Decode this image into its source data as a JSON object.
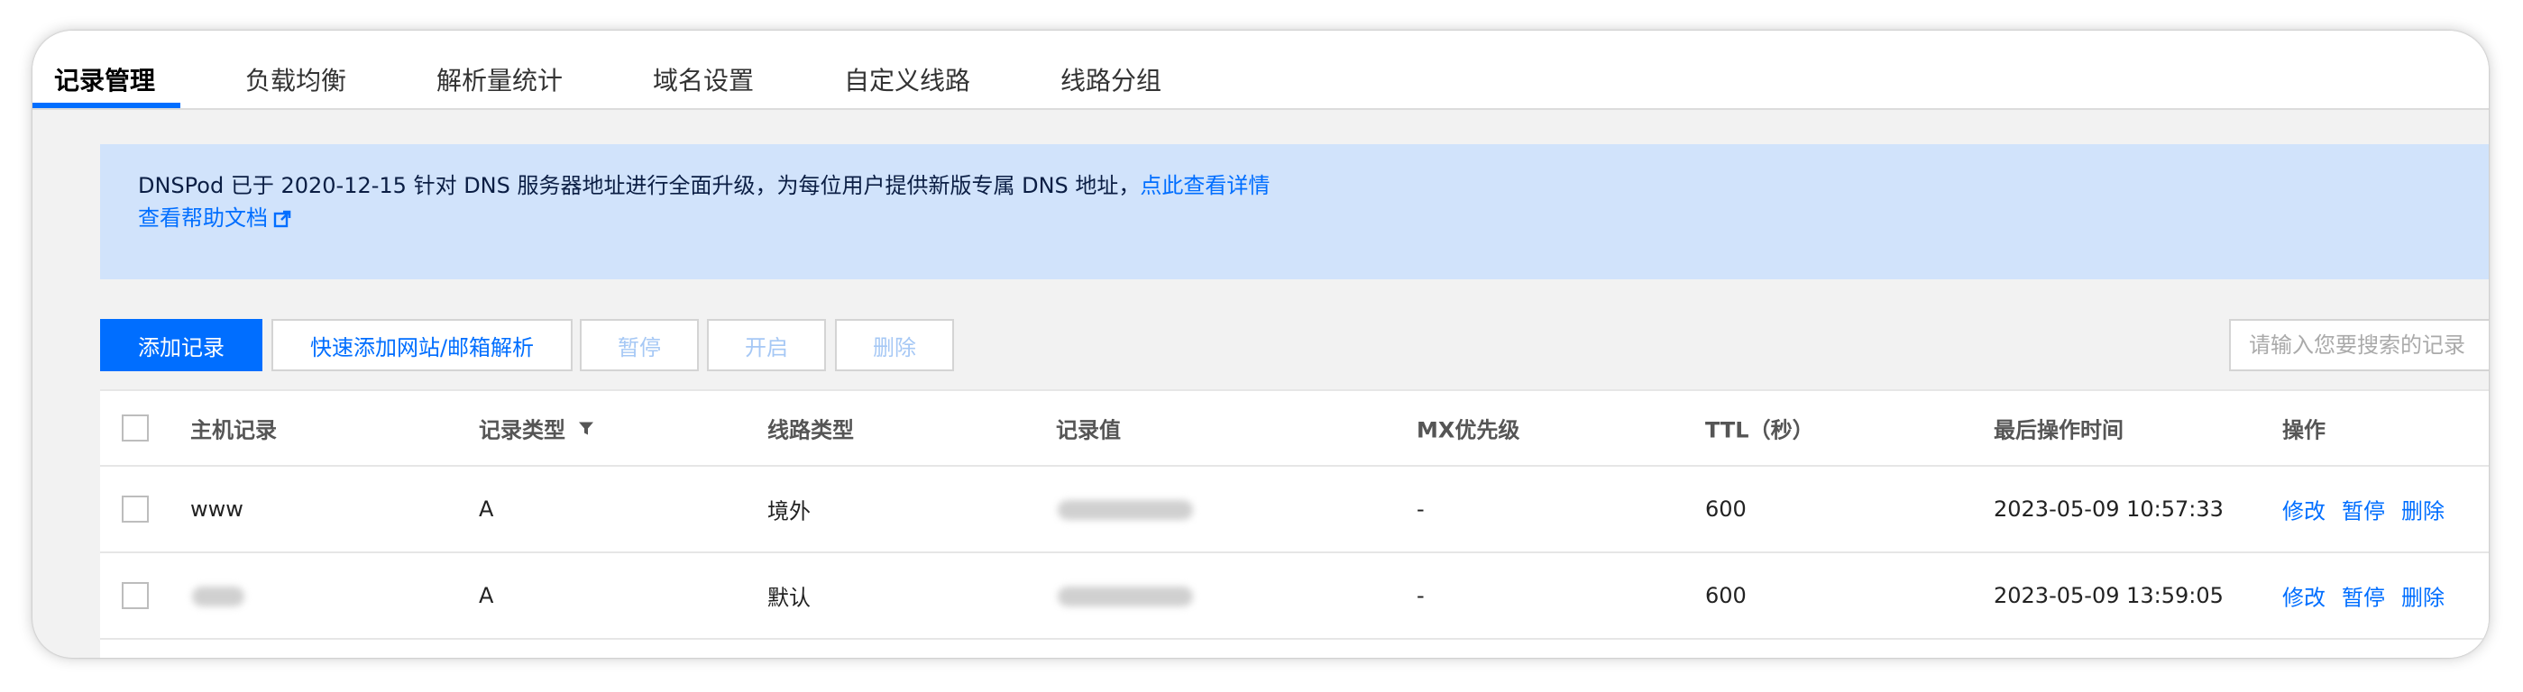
{
  "tabs": [
    "记录管理",
    "负载均衡",
    "解析量统计",
    "域名设置",
    "自定义线路",
    "线路分组"
  ],
  "notice": {
    "text": "DNSPod 已于 2020-12-15 针对 DNS 服务器地址进行全面升级，为每位用户提供新版专属 DNS 地址，",
    "link": "点此查看详情",
    "help_link": "查看帮助文档"
  },
  "toolbar": {
    "add_label": "添加记录",
    "quick_add_label": "快速添加网站/邮箱解析",
    "pause_label": "暂停",
    "enable_label": "开启",
    "delete_label": "删除",
    "search_placeholder": "请输入您要搜索的记录"
  },
  "table": {
    "headers": [
      "主机记录",
      "记录类型",
      "线路类型",
      "记录值",
      "MX优先级",
      "TTL（秒）",
      "最后操作时间",
      "操作"
    ],
    "rows": [
      {
        "host": "www",
        "type": "A",
        "line": "境外",
        "mx": "-",
        "ttl": "600",
        "time": "2023-05-09 10:57:33"
      },
      {
        "host": "",
        "type": "A",
        "line": "默认",
        "mx": "-",
        "ttl": "600",
        "time": "2023-05-09 13:59:05"
      }
    ],
    "actions": {
      "edit": "修改",
      "pause": "暂停",
      "delete": "删除"
    }
  },
  "colors": {
    "primary": "#006eff",
    "notice_bg": "#d1e3fb",
    "page_bg": "#f2f2f2"
  },
  "icons": [
    "external-link-icon",
    "filter-icon",
    "checkbox-icon"
  ]
}
